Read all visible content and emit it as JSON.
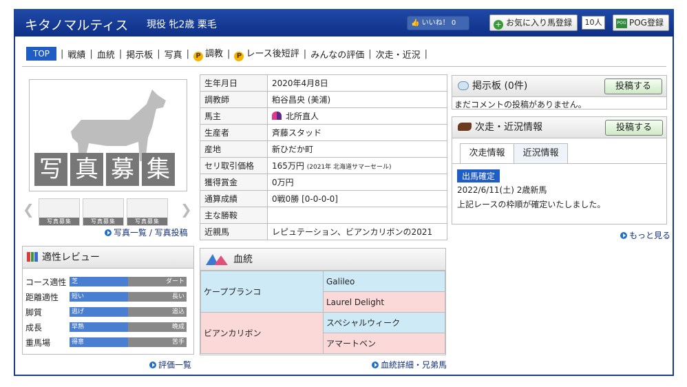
{
  "header": {
    "horse_name": "キタノマルティス",
    "status": "現役 牝2歳 栗毛",
    "like_label": "いいね！",
    "like_count": "0",
    "favorite_label": "お気に入り馬登録",
    "favorite_count": "10人",
    "pog_label": "POG登録",
    "pog_icon_text": "POG"
  },
  "nav": [
    "TOP",
    "戦績",
    "血統",
    "掲示板",
    "写真",
    "調教",
    "レース後短評",
    "みんなの評価",
    "次走・近況"
  ],
  "photo": {
    "label": [
      "写",
      "真",
      "募",
      "集"
    ],
    "thumb_label": "写真募集",
    "links": "写真一覧 / 写真投稿"
  },
  "info": {
    "rows": [
      {
        "k": "生年月日",
        "v": "2020年4月8日"
      },
      {
        "k": "調教師",
        "v": "粕谷昌央 (美浦)"
      },
      {
        "k": "馬主",
        "v": "北所直人"
      },
      {
        "k": "生産者",
        "v": "斉藤スタッド"
      },
      {
        "k": "産地",
        "v": "新ひだか町"
      },
      {
        "k": "セリ取引価格",
        "v": "165万円",
        "note": "(2021年 北海道サマーセール)"
      },
      {
        "k": "獲得賞金",
        "v": "0万円"
      },
      {
        "k": "通算成績",
        "v": "0戦0勝 [0-0-0-0]"
      },
      {
        "k": "主な勝鞍",
        "v": ""
      },
      {
        "k": "近親馬",
        "v": "レピュテーション、ビアンカリボンの2021"
      }
    ]
  },
  "board": {
    "title": "掲示板 (0件)",
    "message": "まだコメントの投稿がありません。",
    "post_label": "投稿する"
  },
  "next": {
    "title": "次走・近況情報",
    "post_label": "投稿する",
    "tabs": [
      "次走情報",
      "近況情報"
    ],
    "badge": "出馬確定",
    "date": "2022/6/11(土) 2歳新馬",
    "desc": "上記レースの枠順が確定いたしました。",
    "more": "もっと見る"
  },
  "aptitude": {
    "title": "適性レビュー",
    "rows": [
      {
        "label": "コース適性",
        "left": "芝",
        "right": "ダート",
        "value": 0.5
      },
      {
        "label": "距離適性",
        "left": "短い",
        "right": "長い",
        "value": 0.5
      },
      {
        "label": "脚質",
        "left": "逃げ",
        "right": "追込",
        "value": 0.5
      },
      {
        "label": "成長",
        "left": "早熟",
        "right": "晩成",
        "value": 0.5
      },
      {
        "label": "重馬場",
        "left": "得意",
        "right": "苦手",
        "value": 0.5
      }
    ],
    "link": "評価一覧"
  },
  "pedigree": {
    "title": "血統",
    "sire": "ケープブランコ",
    "dam": "ビアンカリボン",
    "sire_sire": "Galileo",
    "sire_dam": "Laurel Delight",
    "dam_sire": "スペシャルウィーク",
    "dam_dam": "アマートベン",
    "link": "血統詳細・兄弟馬"
  }
}
